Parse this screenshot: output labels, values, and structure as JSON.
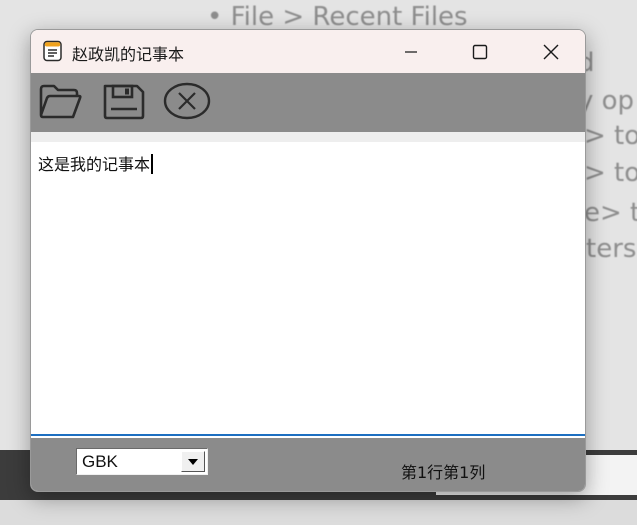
{
  "background": {
    "lines": [
      "• File > Recent Files",
      "d",
      "y op",
      "> to",
      "> to",
      "e> t",
      "ters"
    ]
  },
  "window": {
    "title": "赵政凯的记事本",
    "app_icon": "notepad-icon",
    "controls": {
      "minimize_icon": "minimize-icon",
      "maximize_icon": "maximize-icon",
      "close_icon": "close-icon"
    }
  },
  "toolbar": {
    "buttons": [
      {
        "name": "open",
        "icon": "folder-open-icon"
      },
      {
        "name": "save",
        "icon": "floppy-disk-icon"
      },
      {
        "name": "close",
        "icon": "circle-x-icon"
      }
    ]
  },
  "editor": {
    "content": "这是我的记事本"
  },
  "statusbar": {
    "encoding": "GBK",
    "position": "第1行第1列"
  },
  "colors": {
    "titlebar": "#f9efee",
    "toolbar": "#8b8b8b",
    "statusbar": "#8b8b8b",
    "editor_border": "#1d6fc1"
  }
}
